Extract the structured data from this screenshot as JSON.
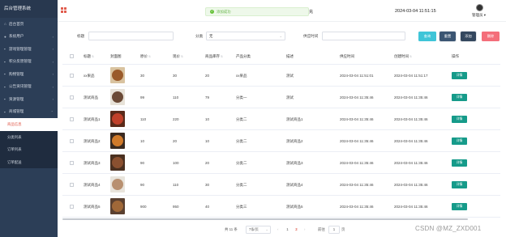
{
  "sidebar": {
    "brand": "后台管理系统",
    "items": [
      {
        "icon": "home-icon",
        "glyph": "⌂",
        "label": "后台首页",
        "arrow": ""
      },
      {
        "icon": "user-icon",
        "glyph": "●",
        "label": "系统用户",
        "arrow": "›"
      },
      {
        "icon": "cart-icon",
        "glyph": "▪",
        "label": "游戏管理管理",
        "arrow": "›"
      },
      {
        "icon": "feedback-icon",
        "glyph": "▪",
        "label": "积分反馈管理",
        "arrow": "›"
      },
      {
        "icon": "cart-icon",
        "glyph": "▪",
        "label": "购物管理",
        "arrow": "›"
      },
      {
        "icon": "notice-icon",
        "glyph": "▪",
        "label": "公告资讯管理",
        "arrow": "›"
      },
      {
        "icon": "gear-icon",
        "glyph": "▪",
        "label": "资源管理",
        "arrow": "›"
      },
      {
        "icon": "shop-icon",
        "glyph": "▪",
        "label": "商城管理",
        "arrow": "⌃"
      }
    ],
    "submenu": [
      "商品信息",
      "分类列表",
      "订单列表",
      "订单配送"
    ]
  },
  "header": {
    "toast": "添加成功",
    "title_fragment": "充",
    "datetime": "2024-03-04 11:51:15",
    "user": "管理员"
  },
  "search": {
    "name_label": "标题",
    "name_value": "",
    "category_label": "分类",
    "category_value": "无",
    "time_label": "供应时间",
    "time_value": "",
    "buttons": {
      "search": "查询",
      "reset": "重置",
      "add": "添加",
      "delete": "删除"
    }
  },
  "colors": {
    "sidebar": "#2c3e57",
    "accent": "#e05b4c",
    "btn_search": "#3fc5d8",
    "btn_reset": "#3b5572",
    "btn_add": "#34475e",
    "btn_delete": "#f46e7a",
    "detail": "#169b8a"
  },
  "table": {
    "headers": [
      "标题",
      "封面图",
      "原价",
      "现价",
      "商品库存",
      "产品分类",
      "描述",
      "供应时间",
      "创建时间",
      "操作"
    ],
    "rows": [
      {
        "title": "xx果品",
        "orig": "30",
        "now": "30",
        "stock": "20",
        "cat": "xx果品",
        "desc": "测试",
        "supply": "2024-03-04 11:51:01",
        "created": "2024-03-04 11:51:17",
        "action": "详情"
      },
      {
        "title": "测试商品",
        "orig": "99",
        "now": "110",
        "stock": "79",
        "cat": "分类一",
        "desc": "测试",
        "supply": "2024-03-04 11:35:46",
        "created": "2024-03-04 11:35:46",
        "action": "详情"
      },
      {
        "title": "测试商品1",
        "orig": "110",
        "now": "220",
        "stock": "10",
        "cat": "分类二",
        "desc": "测试商品1",
        "supply": "2024-03-04 11:35:46",
        "created": "2024-03-04 11:35:46",
        "action": "详情"
      },
      {
        "title": "测试商品2",
        "orig": "10",
        "now": "20",
        "stock": "10",
        "cat": "分类二",
        "desc": "测试商品2",
        "supply": "2024-03-04 11:35:46",
        "created": "2024-03-04 11:35:46",
        "action": "详情"
      },
      {
        "title": "测试商品3",
        "orig": "90",
        "now": "100",
        "stock": "20",
        "cat": "分类二",
        "desc": "测试商品3",
        "supply": "2024-03-04 11:35:46",
        "created": "2024-03-04 11:35:46",
        "action": "详情"
      },
      {
        "title": "测试商品4",
        "orig": "90",
        "now": "110",
        "stock": "30",
        "cat": "分类二",
        "desc": "测试商品4",
        "supply": "2024-03-04 11:35:46",
        "created": "2024-03-04 11:35:46",
        "action": "详情"
      },
      {
        "title": "测试商品5",
        "orig": "900",
        "now": "950",
        "stock": "40",
        "cat": "分类三",
        "desc": "测试商品5",
        "supply": "2024-03-04 11:35:46",
        "created": "2024-03-04 11:35:46",
        "action": "详情"
      }
    ]
  },
  "pagination": {
    "total": "共 11 条",
    "page_size": "7条/页",
    "pages": [
      "1",
      "2"
    ],
    "current": "2",
    "goto_label": "前往",
    "goto_value": "1",
    "goto_suffix": "页"
  },
  "watermark": "CSDN @MZ_ZXD001"
}
